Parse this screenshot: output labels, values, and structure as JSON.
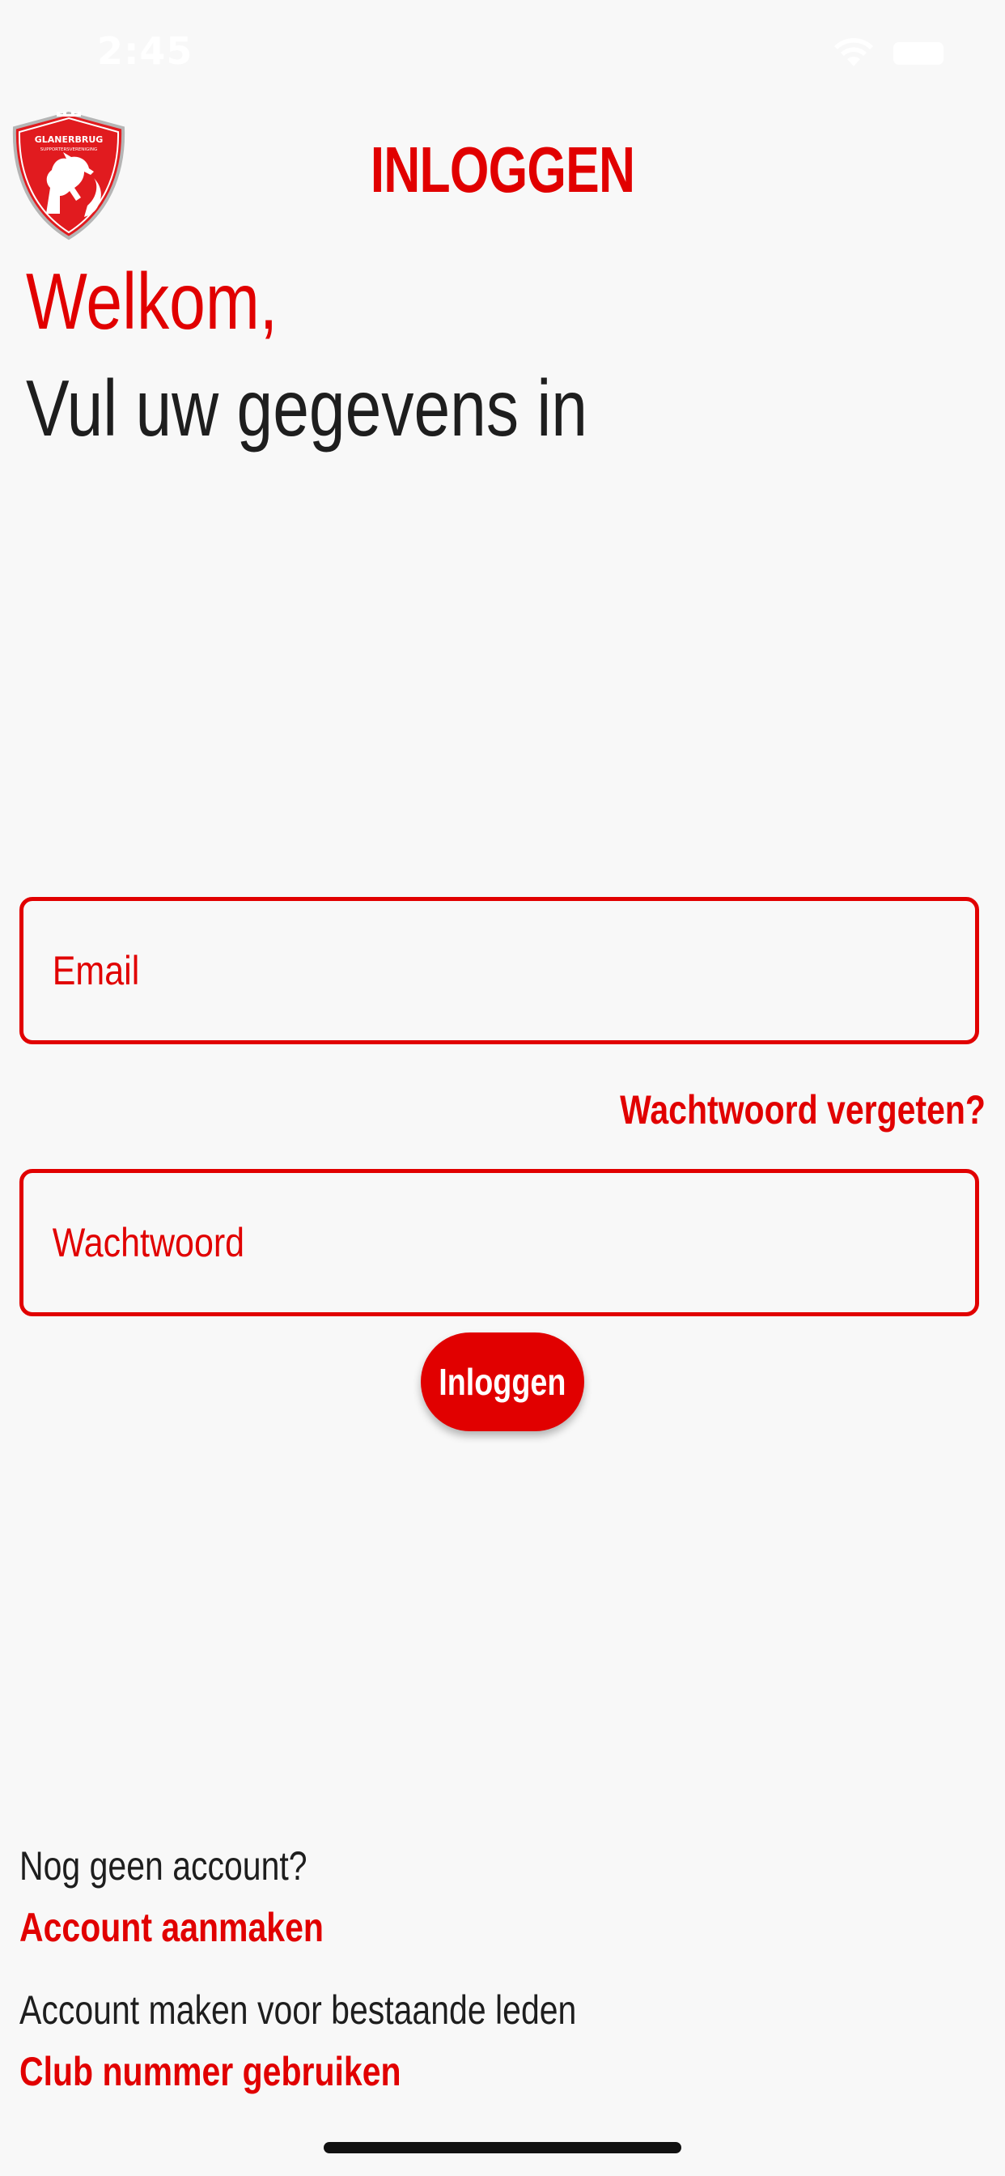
{
  "status_bar": {
    "time": "2:45",
    "wifi_icon": "wifi-icon",
    "battery_icon": "battery-icon"
  },
  "header": {
    "logo_text_line1": "GLANERBRUG",
    "logo_text_line2": "SUPPORTERSVERENIGING",
    "title": "INLOGGEN"
  },
  "welcome": {
    "greeting": "Welkom,",
    "subtitle": "Vul uw gegevens in"
  },
  "form": {
    "email_placeholder": "Email",
    "email_value": "",
    "forgot_password_label": "Wachtwoord vergeten?",
    "password_placeholder": "Wachtwoord",
    "password_value": "",
    "login_button_label": "Inloggen"
  },
  "footer": {
    "no_account_text": "Nog geen account?",
    "create_account_label": "Account aanmaken",
    "existing_members_text": "Account maken voor bestaande leden",
    "club_number_label": "Club nummer gebruiken"
  },
  "colors": {
    "accent": "#e10000",
    "background": "#f8f8f8",
    "text": "#1e1e1e"
  }
}
